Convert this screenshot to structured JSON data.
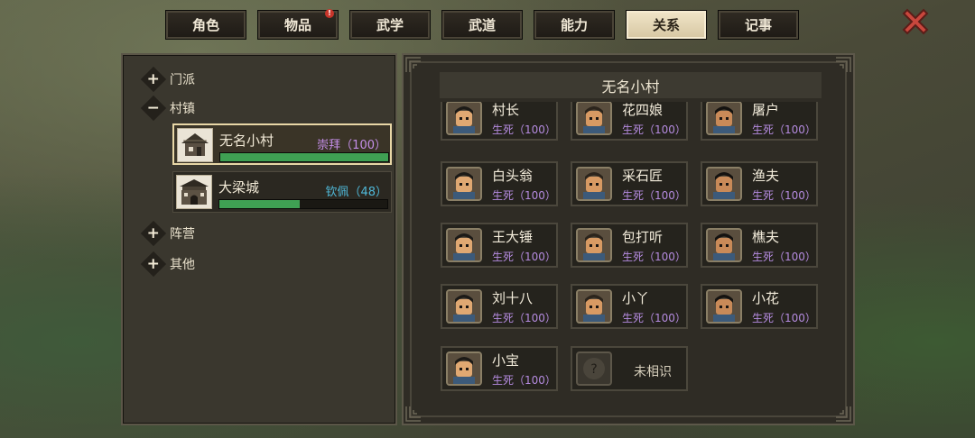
{
  "tabs": [
    {
      "label": "角色",
      "active": false,
      "badge": null
    },
    {
      "label": "物品",
      "active": false,
      "badge": "!"
    },
    {
      "label": "武学",
      "active": false,
      "badge": null
    },
    {
      "label": "武道",
      "active": false,
      "badge": null
    },
    {
      "label": "能力",
      "active": false,
      "badge": null
    },
    {
      "label": "关系",
      "active": true,
      "badge": null
    },
    {
      "label": "记事",
      "active": false,
      "badge": null
    }
  ],
  "close_icon": "close-x-icon",
  "sidebar": {
    "categories": [
      {
        "label": "门派",
        "toggle": "+",
        "expanded": false
      },
      {
        "label": "村镇",
        "toggle": "−",
        "expanded": true
      },
      {
        "label": "阵营",
        "toggle": "+",
        "expanded": false
      },
      {
        "label": "其他",
        "toggle": "+",
        "expanded": false
      }
    ],
    "villages": [
      {
        "name": "无名小村",
        "status": "崇拜（100）",
        "status_color": "#c48ee8",
        "progress": 1.0,
        "selected": true,
        "icon": "village-house-icon"
      },
      {
        "name": "大梁城",
        "status": "钦佩（48）",
        "status_color": "#4fb8d8",
        "progress": 0.48,
        "selected": false,
        "icon": "city-gate-icon"
      }
    ]
  },
  "region": {
    "title": "无名小村",
    "npcs": [
      {
        "name": "村长",
        "status": "生死（100）",
        "icon": "village-chief-portrait"
      },
      {
        "name": "花四娘",
        "status": "生死（100）",
        "icon": "hua-siniang-portrait"
      },
      {
        "name": "屠户",
        "status": "生死（100）",
        "icon": "butcher-portrait"
      },
      {
        "name": "白头翁",
        "status": "生死（100）",
        "icon": "old-man-portrait"
      },
      {
        "name": "采石匠",
        "status": "生死（100）",
        "icon": "stonemason-portrait"
      },
      {
        "name": "渔夫",
        "status": "生死（100）",
        "icon": "fisherman-portrait"
      },
      {
        "name": "王大锤",
        "status": "生死（100）",
        "icon": "wang-dachui-portrait"
      },
      {
        "name": "包打听",
        "status": "生死（100）",
        "icon": "bao-dating-portrait"
      },
      {
        "name": "樵夫",
        "status": "生死（100）",
        "icon": "woodcutter-portrait"
      },
      {
        "name": "刘十八",
        "status": "生死（100）",
        "icon": "liu-shiba-portrait"
      },
      {
        "name": "小丫",
        "status": "生死（100）",
        "icon": "xiaoya-portrait"
      },
      {
        "name": "小花",
        "status": "生死（100）",
        "icon": "xiaohua-portrait"
      },
      {
        "name": "小宝",
        "status": "生死（100）",
        "icon": "xiaobao-portrait"
      }
    ],
    "unknown": {
      "label": "未相识",
      "icon": "question-mark-icon"
    }
  },
  "colors": {
    "npc_status": "#b58be0",
    "bar_fill": "#3fa053",
    "active_tab": "#efe3c6"
  }
}
